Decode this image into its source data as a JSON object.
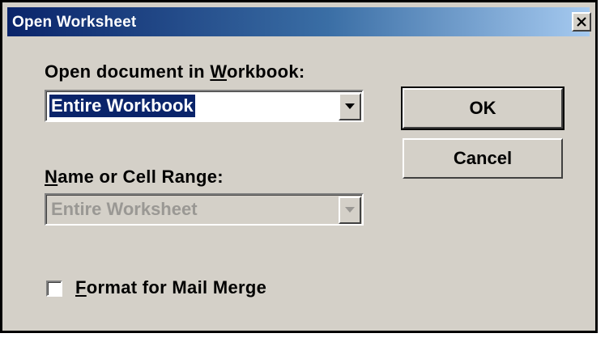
{
  "window": {
    "title": "Open Worksheet",
    "close_icon": "close-icon"
  },
  "workbook_field": {
    "label_mnemonic": "W",
    "label_before": "Open document in ",
    "label_after": "orkbook:",
    "value": "Entire Workbook",
    "dropdown_icon": "chevron-down-icon"
  },
  "range_field": {
    "label_mnemonic": "N",
    "label_rest": "ame or Cell Range:",
    "value": "Entire Worksheet",
    "disabled": true,
    "dropdown_icon": "chevron-down-icon"
  },
  "buttons": {
    "ok_label": "OK",
    "cancel_label": "Cancel"
  },
  "mail_merge": {
    "label_mnemonic": "F",
    "label_rest": "ormat for Mail Merge",
    "checked": false
  },
  "colors": {
    "face": "#d4d0c8",
    "title_start": "#0a246a",
    "title_end": "#a6caf0",
    "selection": "#0a246a",
    "disabled_text": "#9a9894"
  }
}
